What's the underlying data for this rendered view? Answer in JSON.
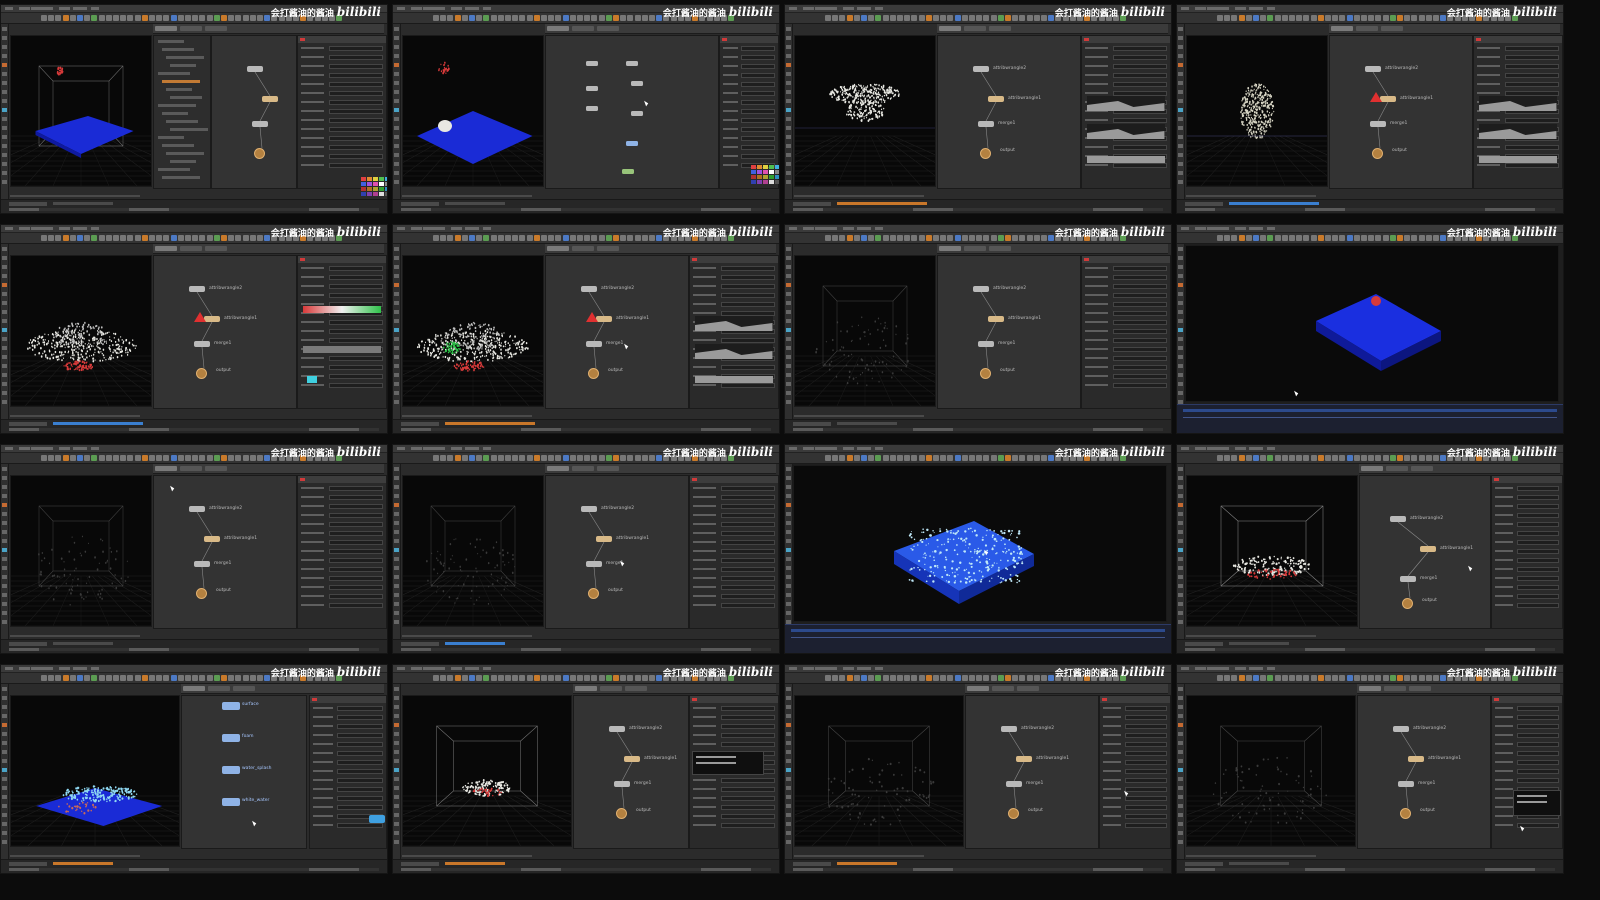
{
  "watermark": {
    "channel": "会打酱油的酱油",
    "platform": "bilibili"
  },
  "colors": {
    "water_blue": "#1a2bd6",
    "particle_white": "#e8e8e2",
    "particle_red": "#d83a3a",
    "particle_green": "#2fc24a",
    "node_orange": "#d8b987",
    "node_blue": "#8fb3e6",
    "warning_red": "#e03030",
    "timeline_orange": "#c9772a",
    "timeline_blue": "#3a7fd0"
  },
  "tiles": [
    {
      "id": 1,
      "view": "flip tank with blue water plane and red source",
      "nodes": [],
      "tree_panel": true,
      "palette": true
    },
    {
      "id": 2,
      "view": "blue water plane with white emitter",
      "nodes": [],
      "palette": true
    },
    {
      "id": 3,
      "view": "white particle mushroom splash",
      "nodes": [
        "attribwrangle2",
        "attribwrangle1",
        "merge1",
        "output"
      ]
    },
    {
      "id": 4,
      "view": "white particle cube",
      "nodes": [
        "attribwrangle2",
        "attribwrangle1",
        "merge1",
        "output"
      ],
      "warning": true
    },
    {
      "id": 5,
      "view": "white particle splash with red",
      "nodes": [
        "attribwrangle2",
        "attribwrangle1",
        "merge1",
        "output"
      ],
      "warning": true
    },
    {
      "id": 6,
      "view": "splash with green and red highlights",
      "nodes": [
        "attribwrangle2",
        "attribwrangle1",
        "merge1",
        "output"
      ],
      "warning": true
    },
    {
      "id": 7,
      "view": "empty wireframe box",
      "nodes": [
        "attribwrangle2",
        "attribwrangle1",
        "merge1",
        "output"
      ]
    },
    {
      "id": 8,
      "view": "fullscreen blue water block",
      "fullscreen": true
    },
    {
      "id": 9,
      "view": "empty wireframe box",
      "nodes": [
        "attribwrangle2",
        "attribwrangle1",
        "merge1",
        "output"
      ]
    },
    {
      "id": 10,
      "view": "empty wireframe box",
      "nodes": [
        "attribwrangle2",
        "attribwrangle1",
        "merge1",
        "output"
      ]
    },
    {
      "id": 11,
      "view": "fullscreen foamy water block",
      "fullscreen": true
    },
    {
      "id": 12,
      "view": "box with white and red splash",
      "nodes": [
        "attribwrangle2",
        "attribwrangle1",
        "merge1",
        "output"
      ]
    },
    {
      "id": 13,
      "view": "blue water with cyan splash",
      "nodes": [
        "surface",
        "foam",
        "water_splash",
        "white_water"
      ]
    },
    {
      "id": 14,
      "view": "box with white particles",
      "nodes": [
        "attribwrangle2",
        "attribwrangle1",
        "merge1",
        "output"
      ]
    },
    {
      "id": 15,
      "view": "empty box",
      "nodes": [
        "attribwrangle2",
        "attribwrangle1",
        "merge1",
        "output"
      ]
    },
    {
      "id": 16,
      "view": "empty box",
      "nodes": [
        "attribwrangle2",
        "attribwrangle1",
        "merge1",
        "output"
      ]
    }
  ]
}
